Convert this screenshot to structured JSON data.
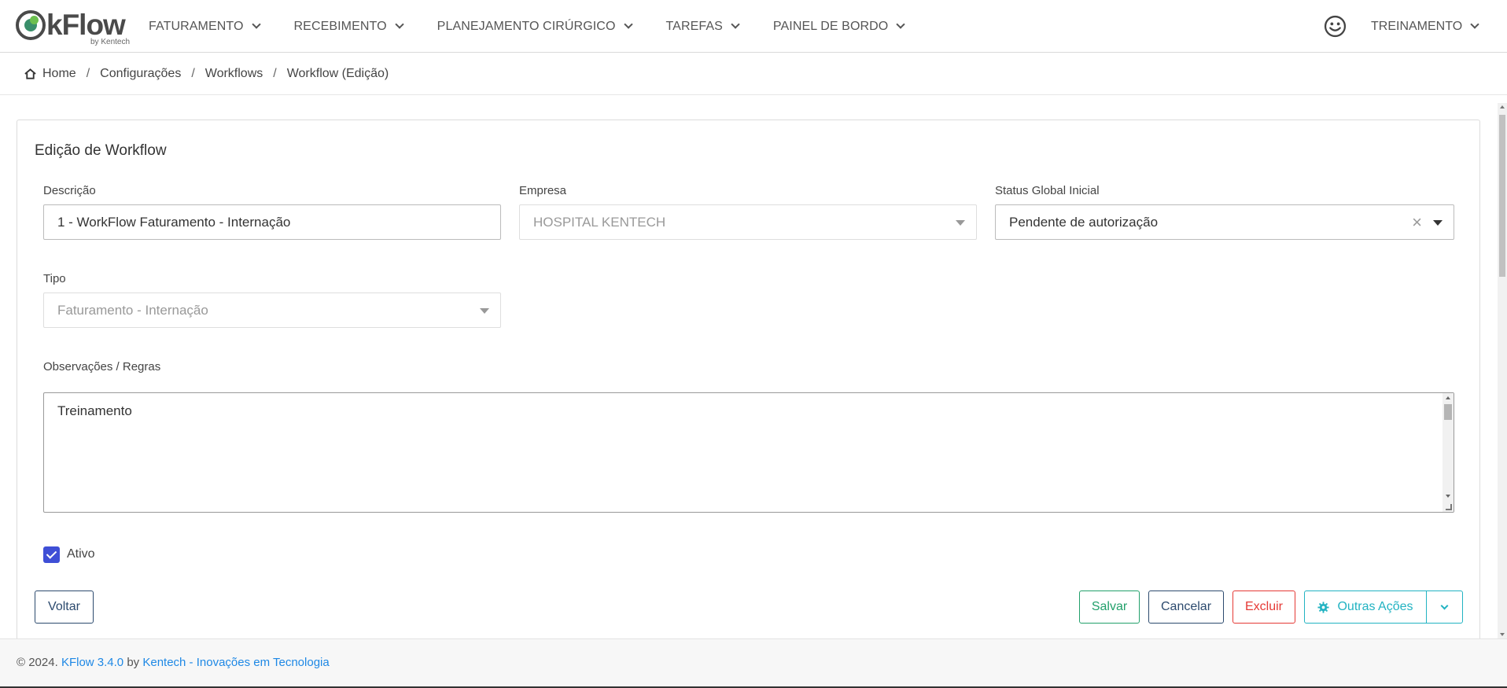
{
  "app": {
    "logo_text": "kFlow",
    "logo_sub": "by Kentech"
  },
  "nav": {
    "items": [
      {
        "label": "FATURAMENTO"
      },
      {
        "label": "RECEBIMENTO"
      },
      {
        "label": "PLANEJAMENTO CIRÚRGICO"
      },
      {
        "label": "TAREFAS"
      },
      {
        "label": "PAINEL DE BORDO"
      }
    ],
    "user": "TREINAMENTO"
  },
  "breadcrumb": [
    "Home",
    "Configurações",
    "Workflows",
    "Workflow (Edição)"
  ],
  "form": {
    "title": "Edição de Workflow",
    "descricao": {
      "label": "Descrição",
      "value": "1 - WorkFlow Faturamento - Internação"
    },
    "empresa": {
      "label": "Empresa",
      "value": "HOSPITAL KENTECH"
    },
    "status": {
      "label": "Status Global Inicial",
      "value": "Pendente de autorização"
    },
    "tipo": {
      "label": "Tipo",
      "value": "Faturamento - Internação"
    },
    "observacoes": {
      "label": "Observações / Regras",
      "value": "Treinamento"
    },
    "ativo": {
      "label": "Ativo",
      "checked": true
    }
  },
  "buttons": {
    "voltar": "Voltar",
    "salvar": "Salvar",
    "cancelar": "Cancelar",
    "excluir": "Excluir",
    "outras": "Outras Ações"
  },
  "footer": {
    "prefix": "© 2024.",
    "version": "KFlow 3.4.0",
    "by": "by",
    "company": "Kentech - Inovações em Tecnologia"
  },
  "colors": {
    "primary_outline": "#2c4a6e",
    "success": "#22a06b",
    "danger": "#e53935",
    "info": "#22b3c2",
    "checkbox": "#3f4fd6",
    "link": "#1e88e5"
  }
}
